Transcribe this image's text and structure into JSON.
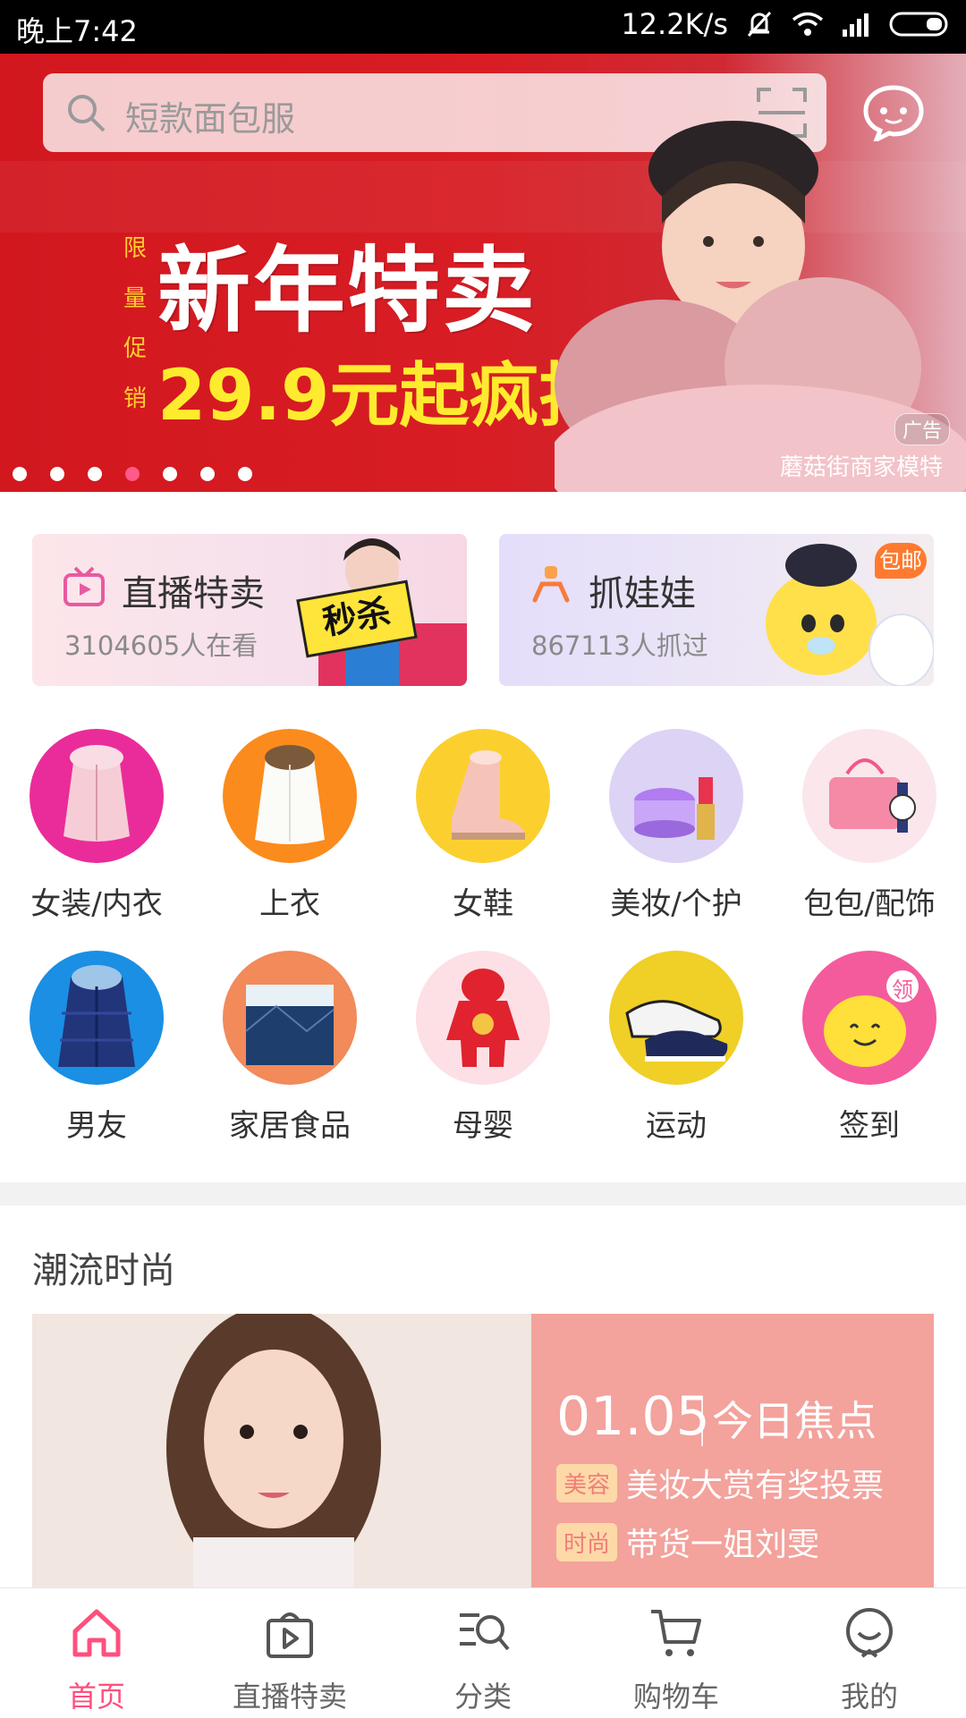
{
  "status_bar": {
    "time": "晚上7:42",
    "speed": "12.2K/s"
  },
  "search": {
    "placeholder": "短款面包服"
  },
  "banner": {
    "vertical_text": [
      "限",
      "量",
      "促",
      "销"
    ],
    "title": "新年特卖",
    "price_text": "29.9元起疯抢",
    "ad_tag": "广告",
    "caption": "蘑菇街商家模特",
    "dot_count": 7,
    "active_dot": 3
  },
  "live_card": {
    "title": "直播特卖",
    "subtitle": "3104605人在看",
    "stamp": "秒杀"
  },
  "claw_card": {
    "title": "抓娃娃",
    "subtitle": "867113人抓过",
    "tag": "包邮"
  },
  "categories": [
    {
      "label": "女装/内衣",
      "icon": "pink-coat-icon",
      "bg": "#ea2c9a"
    },
    {
      "label": "上衣",
      "icon": "white-jacket-icon",
      "bg": "#fb8b1c"
    },
    {
      "label": "女鞋",
      "icon": "boot-icon",
      "bg": "#fbd02e"
    },
    {
      "label": "美妆/个护",
      "icon": "cosmetics-icon",
      "bg": "#ddd3f5"
    },
    {
      "label": "包包/配饰",
      "icon": "handbag-icon",
      "bg": "#fbe6ec"
    },
    {
      "label": "男友",
      "icon": "puffer-jacket-icon",
      "bg": "#1a8fe4"
    },
    {
      "label": "家居食品",
      "icon": "bedding-icon",
      "bg": "#f28a5a"
    },
    {
      "label": "母婴",
      "icon": "baby-suit-icon",
      "bg": "#fce0e6"
    },
    {
      "label": "运动",
      "icon": "sneaker-icon",
      "bg": "#f0cf27"
    },
    {
      "label": "签到",
      "icon": "checkin-smiley-icon",
      "bg": "#f45b9c",
      "tag": "领"
    }
  ],
  "section": {
    "title": "潮流时尚"
  },
  "feature": {
    "date": "01.05",
    "focus_label": "今日焦点",
    "items": [
      {
        "badge": "美容",
        "text": "美妆大赏有奖投票"
      },
      {
        "badge": "时尚",
        "text": "带货一姐刘雯"
      }
    ]
  },
  "tabs": [
    {
      "label": "首页",
      "icon": "home-icon",
      "active": true
    },
    {
      "label": "直播特卖",
      "icon": "live-bag-icon",
      "active": false
    },
    {
      "label": "分类",
      "icon": "category-search-icon",
      "active": false
    },
    {
      "label": "购物车",
      "icon": "cart-icon",
      "active": false
    },
    {
      "label": "我的",
      "icon": "profile-smile-icon",
      "active": false
    }
  ],
  "colors": {
    "accent": "#ff4f7e",
    "banner_red": "#d81d24",
    "feature_panel": "#f3a29c"
  }
}
